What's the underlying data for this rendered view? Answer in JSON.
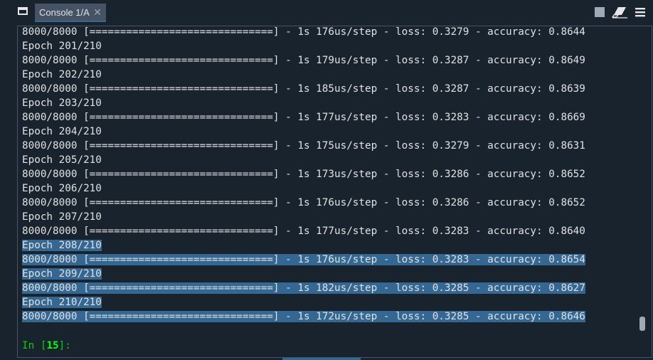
{
  "tab": {
    "label": "Console 1/A",
    "close": "✕"
  },
  "toolbar": {
    "stop": "stop-icon",
    "clear": "eraser-icon",
    "menu": "menu-icon"
  },
  "output_lines": [
    {
      "text": "8000/8000 [==============================] - 1s 176us/step - loss: 0.3279 - accuracy: 0.8644",
      "selected": false
    },
    {
      "text": "Epoch 201/210",
      "selected": false
    },
    {
      "text": "8000/8000 [==============================] - 1s 179us/step - loss: 0.3287 - accuracy: 0.8649",
      "selected": false
    },
    {
      "text": "Epoch 202/210",
      "selected": false
    },
    {
      "text": "8000/8000 [==============================] - 1s 185us/step - loss: 0.3287 - accuracy: 0.8639",
      "selected": false
    },
    {
      "text": "Epoch 203/210",
      "selected": false
    },
    {
      "text": "8000/8000 [==============================] - 1s 177us/step - loss: 0.3283 - accuracy: 0.8669",
      "selected": false
    },
    {
      "text": "Epoch 204/210",
      "selected": false
    },
    {
      "text": "8000/8000 [==============================] - 1s 175us/step - loss: 0.3279 - accuracy: 0.8631",
      "selected": false
    },
    {
      "text": "Epoch 205/210",
      "selected": false
    },
    {
      "text": "8000/8000 [==============================] - 1s 173us/step - loss: 0.3286 - accuracy: 0.8652",
      "selected": false
    },
    {
      "text": "Epoch 206/210",
      "selected": false
    },
    {
      "text": "8000/8000 [==============================] - 1s 176us/step - loss: 0.3286 - accuracy: 0.8652",
      "selected": false
    },
    {
      "text": "Epoch 207/210",
      "selected": false
    },
    {
      "text": "8000/8000 [==============================] - 1s 177us/step - loss: 0.3283 - accuracy: 0.8640",
      "selected": false
    },
    {
      "text": "Epoch 208/210",
      "selected": true
    },
    {
      "text": "8000/8000 [==============================] - 1s 176us/step - loss: 0.3283 - accuracy: 0.8654",
      "selected": true
    },
    {
      "text": "Epoch 209/210",
      "selected": true
    },
    {
      "text": "8000/8000 [==============================] - 1s 182us/step - loss: 0.3285 - accuracy: 0.8627",
      "selected": true
    },
    {
      "text": "Epoch 210/210",
      "selected": true
    },
    {
      "text": "8000/8000 [==============================] - 1s 172us/step - loss: 0.3285 - accuracy: 0.8646",
      "selected": true
    }
  ],
  "prompt": {
    "prefix": "In [",
    "number": "15",
    "suffix": "]:"
  },
  "colors": {
    "background": "#19232d",
    "selection": "#346792",
    "text": "#e0e1e3",
    "prompt": "#00ff00"
  }
}
